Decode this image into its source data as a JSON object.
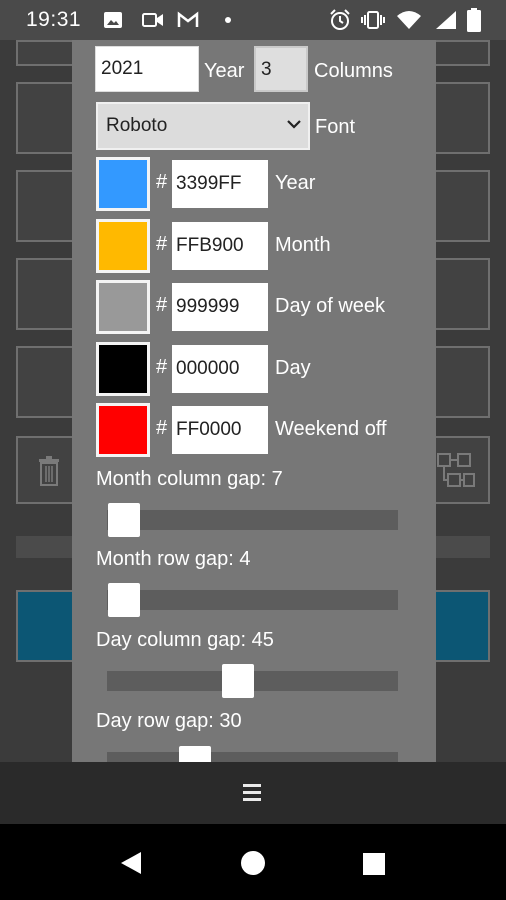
{
  "status_bar": {
    "time": "19:31",
    "left_icons": [
      "image-icon",
      "video-camera-icon",
      "gmail-icon",
      "dot-icon"
    ],
    "right_icons": [
      "alarm-icon",
      "vibrate-icon",
      "wifi-icon",
      "signal-icon",
      "battery-icon"
    ]
  },
  "settings": {
    "year_value": "2021",
    "year_label": "Year",
    "columns_value": "3",
    "columns_label": "Columns",
    "font_value": "Roboto",
    "font_label": "Font",
    "colors": [
      {
        "swatch": "#3399FF",
        "hex": "3399FF",
        "label": "Year"
      },
      {
        "swatch": "#FFB900",
        "hex": "FFB900",
        "label": "Month"
      },
      {
        "swatch": "#999999",
        "hex": "999999",
        "label": "Day of week"
      },
      {
        "swatch": "#000000",
        "hex": "000000",
        "label": "Day"
      },
      {
        "swatch": "#FF0000",
        "hex": "FF0000",
        "label": "Weekend off"
      }
    ],
    "hash_symbol": "#",
    "sliders": [
      {
        "label": "Month column gap: 7",
        "value": 7
      },
      {
        "label": "Month row gap: 4",
        "value": 4
      },
      {
        "label": "Day column gap: 45",
        "value": 45
      },
      {
        "label": "Day row gap: 30",
        "value": 30
      }
    ]
  },
  "background_icons": [
    "trash-icon",
    "grid-layout-icon"
  ],
  "app_bar": {
    "menu_icon": "hamburger-menu-icon"
  },
  "nav_bar": {
    "icons": [
      "back-icon",
      "home-icon",
      "recents-icon"
    ]
  }
}
